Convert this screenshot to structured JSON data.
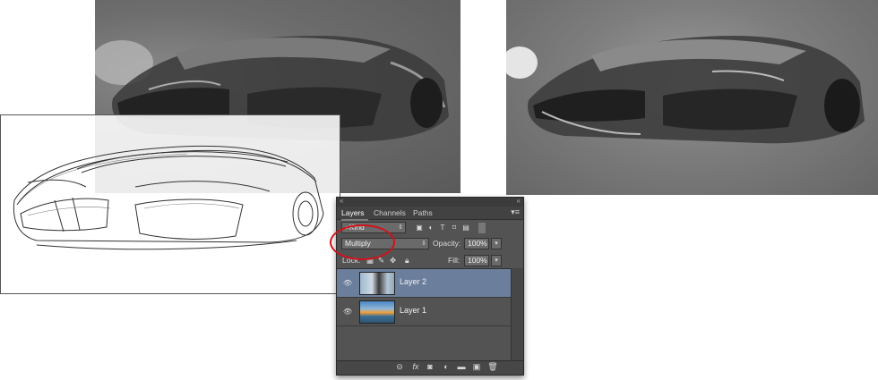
{
  "panel": {
    "tabs": [
      "Layers",
      "Channels",
      "Paths"
    ],
    "filter": {
      "kind_label": "Kind",
      "icons": [
        "image-filter-icon",
        "adjustment-filter-icon",
        "type-filter-icon",
        "shape-filter-icon",
        "smart-object-filter-icon"
      ]
    },
    "blend_mode": "Multiply",
    "opacity_label": "Opacity:",
    "opacity_value": "100%",
    "lock_label": "Lock:",
    "fill_label": "Fill:",
    "fill_value": "100%",
    "layers": [
      {
        "name": "Layer 2",
        "selected": true,
        "visible": true
      },
      {
        "name": "Layer 1",
        "selected": false,
        "visible": true
      }
    ],
    "bottom_icons": [
      "link-icon",
      "fx-icon",
      "mask-icon",
      "adjustment-icon",
      "folder-icon",
      "new-layer-icon",
      "trash-icon"
    ],
    "fx_label": "fx"
  },
  "annotation": {
    "color": "#d0121b"
  }
}
